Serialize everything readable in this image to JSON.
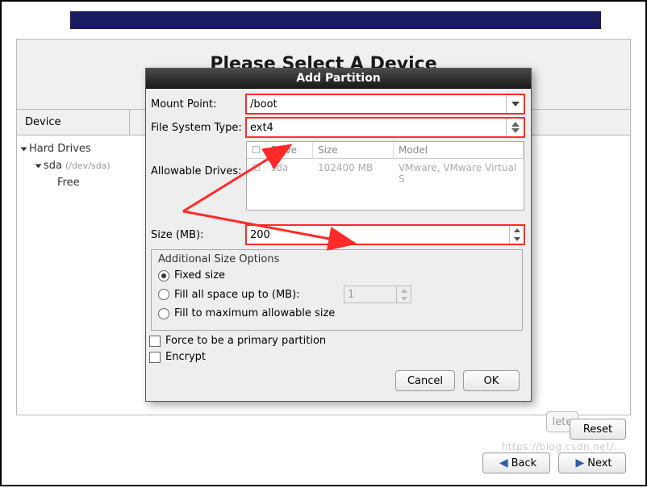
{
  "page": {
    "title": "Please Select A Device",
    "device_col": "Device"
  },
  "tree": {
    "root": "Hard Drives",
    "disk": "sda",
    "disk_path": "(/dev/sda)",
    "free": "Free"
  },
  "dialog": {
    "title": "Add Partition",
    "mount_label": "Mount Point:",
    "mount_value": "/boot",
    "fs_label": "File System Type:",
    "fs_value": "ext4",
    "drives_label": "Allowable Drives:",
    "drives_cols": {
      "drive": "Drive",
      "size": "Size",
      "model": "Model"
    },
    "drives_row": {
      "drive": "sda",
      "size": "102400 MB",
      "model": "VMware, VMware Virtual S"
    },
    "size_label": "Size (MB):",
    "size_value": "200",
    "addl_title": "Additional Size Options",
    "opt_fixed": "Fixed size",
    "opt_upto": "Fill all space up to (MB):",
    "opt_upto_val": "1",
    "opt_max": "Fill to maximum allowable size",
    "force_primary": "Force to be a primary partition",
    "encrypt": "Encrypt",
    "cancel": "Cancel",
    "ok": "OK"
  },
  "buttons": {
    "delete_suffix": "lete",
    "reset": "Reset",
    "back": "Back",
    "next": "Next"
  },
  "watermark": "https://blog.csdn.net/..."
}
